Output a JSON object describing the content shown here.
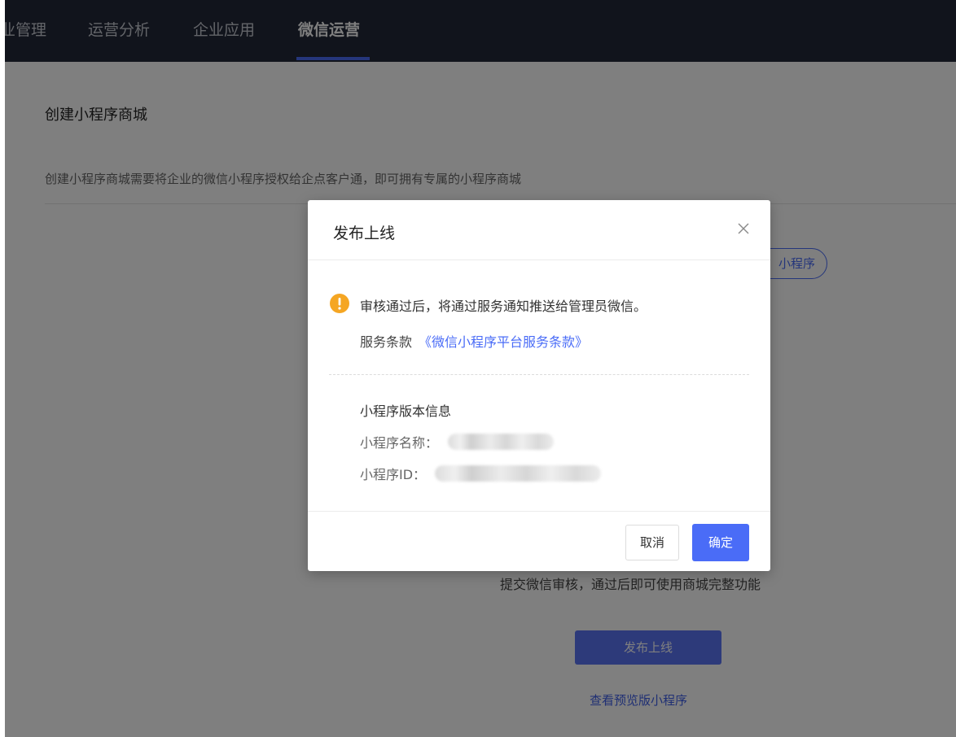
{
  "topnav": {
    "items": [
      {
        "label": "业管理",
        "active": false
      },
      {
        "label": "运营分析",
        "active": false
      },
      {
        "label": "企业应用",
        "active": false
      },
      {
        "label": "微信运营",
        "active": true
      }
    ]
  },
  "page": {
    "title": "创建小程序商城",
    "description": "创建小程序商城需要将企业的微信小程序授权给企点客户通，即可拥有专属的小程序商城",
    "pill_button_label": "小程序",
    "step_description": "提交微信审核，通过后即可使用商城完整功能",
    "publish_button_label": "发布上线",
    "preview_link_label": "查看预览版小程序"
  },
  "modal": {
    "title": "发布上线",
    "notice": "审核通过后，将通过服务通知推送给管理员微信。",
    "terms_label": "服务条款",
    "terms_link": "《微信小程序平台服务条款》",
    "info_title": "小程序版本信息",
    "name_label": "小程序名称：",
    "id_label": "小程序ID：",
    "cancel_label": "取消",
    "confirm_label": "确定"
  },
  "colors": {
    "nav_bg": "#232838",
    "accent": "#4a6cf7",
    "warning": "#f5a623"
  }
}
